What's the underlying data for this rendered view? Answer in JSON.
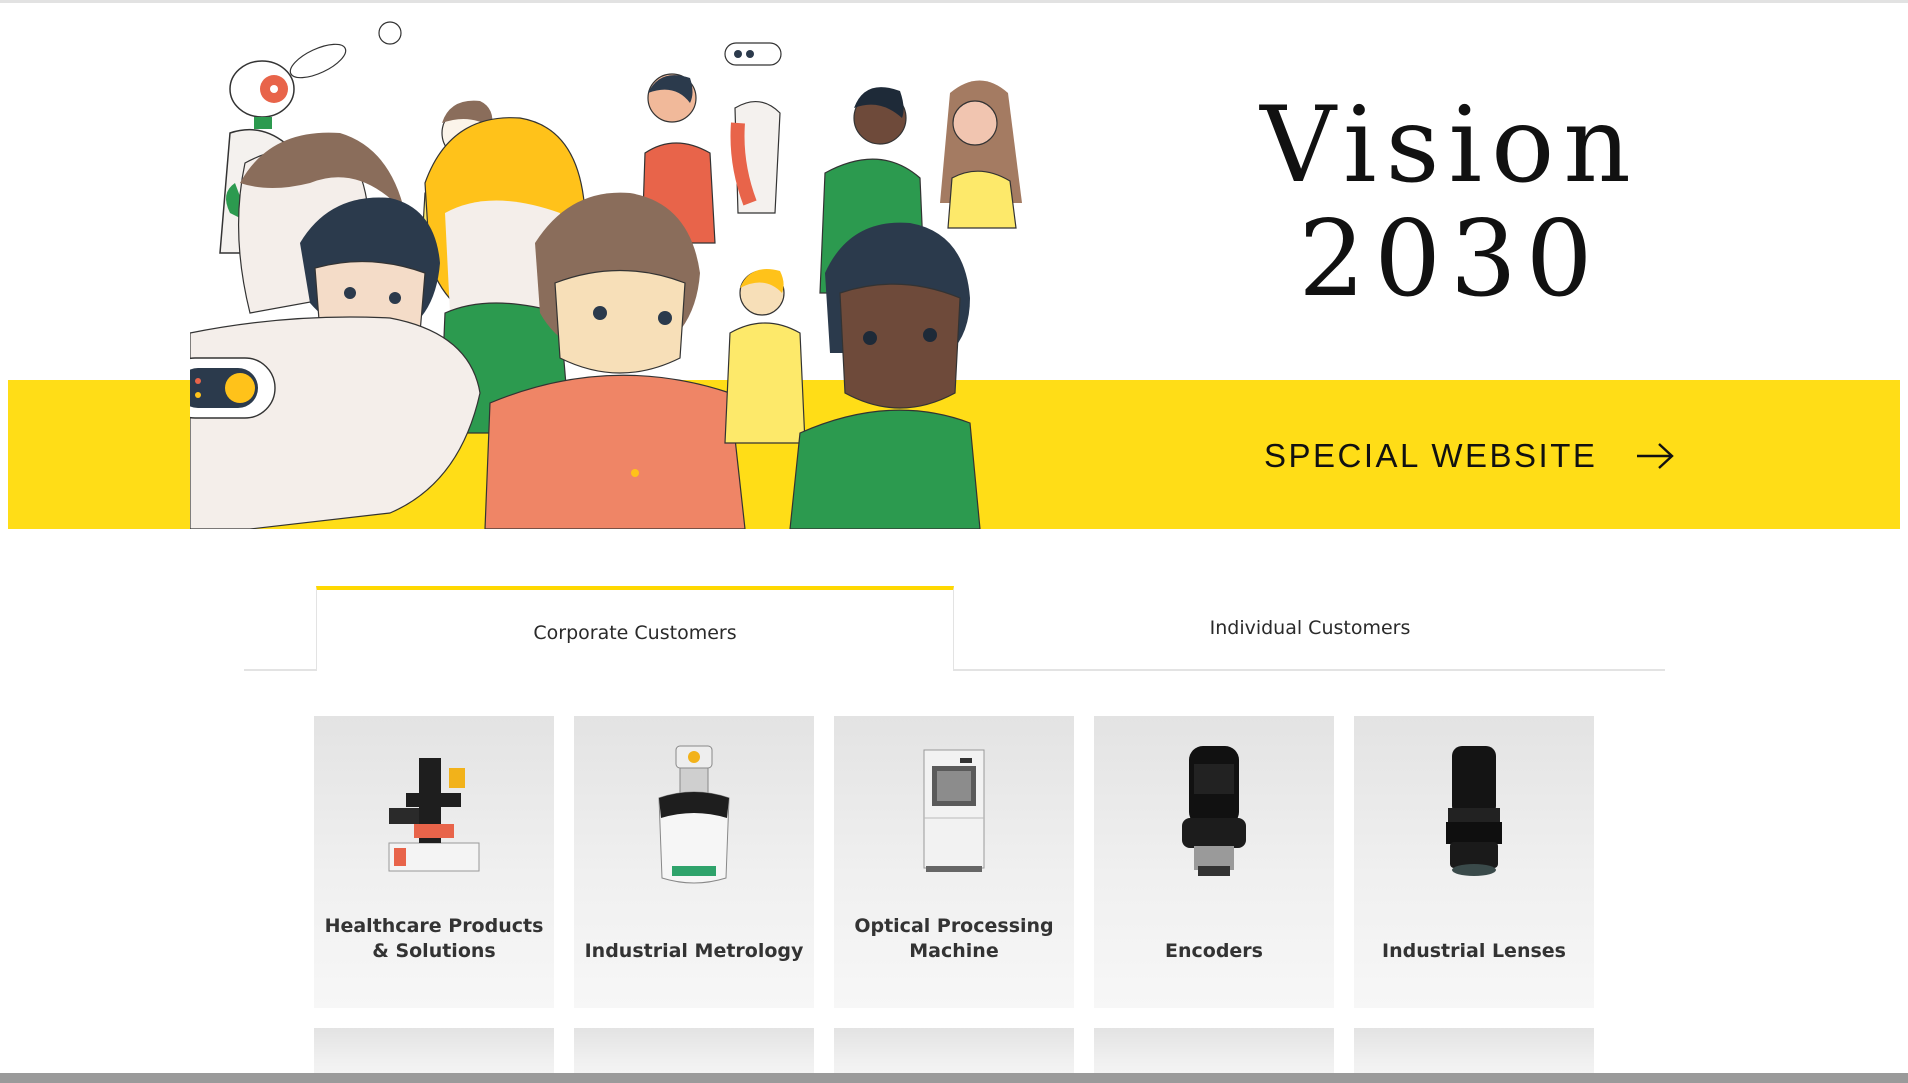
{
  "hero": {
    "title_line1": "Vision",
    "title_line2": "2030",
    "link_label": "SPECIAL WEBSITE",
    "band_color": "#ffdd17",
    "arrow_icon": "arrow-right-icon"
  },
  "tabs": {
    "corporate_label": "Corporate Customers",
    "individual_label": "Individual Customers",
    "active_tab": "Corporate Customers",
    "accent_color": "#ffd800"
  },
  "products": [
    {
      "label": "Healthcare Products & Solutions",
      "icon": "microscope-icon"
    },
    {
      "label": "Industrial Metrology",
      "icon": "measuring-robot-icon"
    },
    {
      "label": "Optical Processing Machine",
      "icon": "processing-machine-icon"
    },
    {
      "label": "Encoders",
      "icon": "encoder-icon"
    },
    {
      "label": "Industrial Lenses",
      "icon": "lens-icon"
    }
  ]
}
